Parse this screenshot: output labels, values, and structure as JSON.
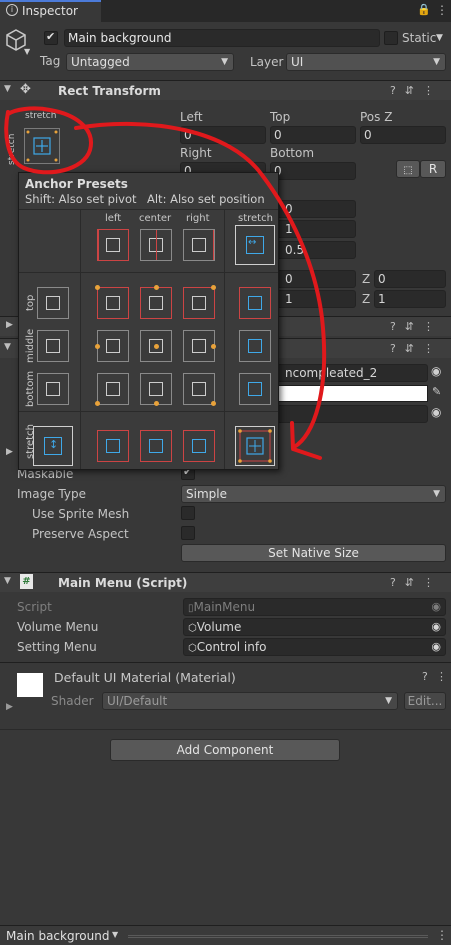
{
  "tab": {
    "title": "Inspector"
  },
  "object": {
    "name": "Main background",
    "static_label": "Static",
    "tag_label": "Tag",
    "tag_value": "Untagged",
    "layer_label": "Layer",
    "layer_value": "UI"
  },
  "rect_transform": {
    "title": "Rect Transform",
    "anchor_h": "stretch",
    "anchor_v": "stretch",
    "left_label": "Left",
    "left_value": "0",
    "top_label": "Top",
    "top_value": "0",
    "posz_label": "Pos Z",
    "posz_value": "0",
    "right_label": "Right",
    "right_value": "0",
    "bottom_label": "Bottom",
    "bottom_value": "0",
    "r_button": "R",
    "hidden_fields": [
      "0",
      "1",
      "0.5"
    ],
    "z_label": "Z",
    "rot_x": "0",
    "rot_z": "0",
    "scale_x": "1",
    "scale_z": "1"
  },
  "anchor_presets": {
    "title": "Anchor Presets",
    "hint_shift": "Shift: Also set pivot",
    "hint_alt": "Alt: Also set position",
    "col_labels": [
      "left",
      "center",
      "right",
      "stretch"
    ],
    "row_labels": [
      "top",
      "middle",
      "bottom",
      "stretch"
    ]
  },
  "image": {
    "source_partial": "ncompleated_2",
    "maskable_label": "Maskable",
    "image_type_label": "Image Type",
    "image_type_value": "Simple",
    "use_sprite_mesh_label": "Use Sprite Mesh",
    "preserve_aspect_label": "Preserve Aspect",
    "set_native_size_button": "Set Native Size"
  },
  "main_menu": {
    "title": "Main Menu (Script)",
    "script_label": "Script",
    "script_value": "MainMenu",
    "volume_menu_label": "Volume Menu",
    "volume_menu_value": "Volume",
    "setting_menu_label": "Setting Menu",
    "setting_menu_value": "Control info"
  },
  "material": {
    "title": "Default UI Material (Material)",
    "shader_label": "Shader",
    "shader_value": "UI/Default",
    "edit_button": "Edit..."
  },
  "add_component_button": "Add Component",
  "footer": {
    "object_name": "Main background"
  },
  "colors": {
    "annotation": "#e0191c",
    "anchor_blue": "#3fa8e8",
    "anchor_orange": "#e8a23a",
    "selected_border": "#cfcfcf"
  }
}
